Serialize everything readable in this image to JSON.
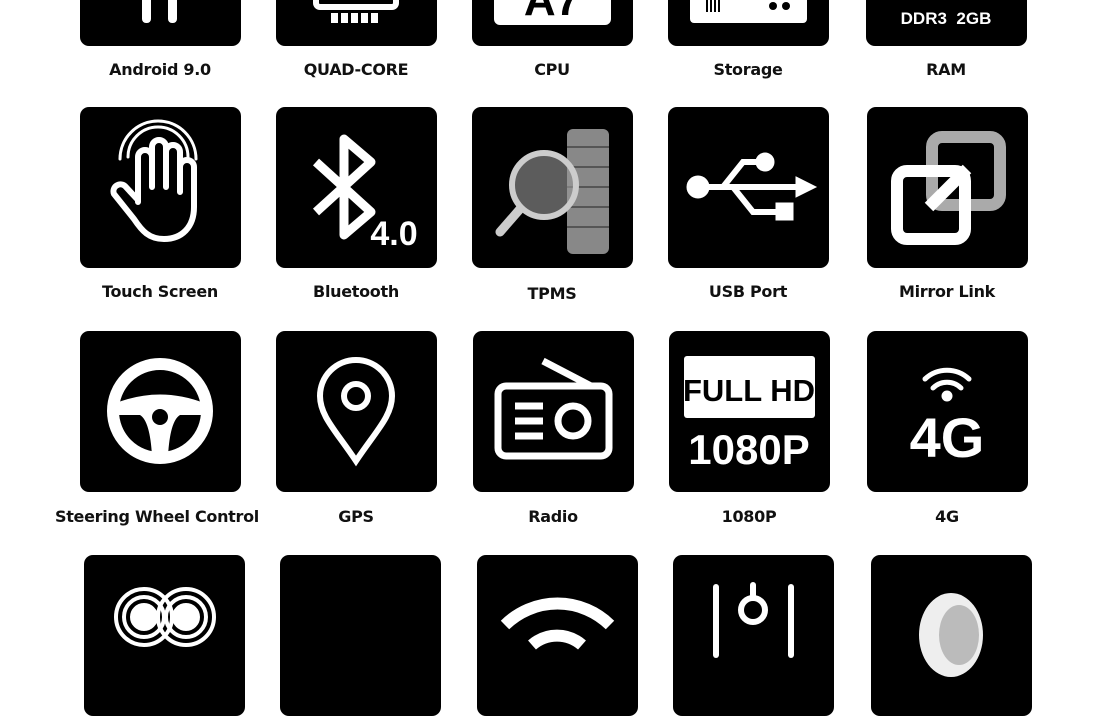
{
  "features": [
    {
      "label": "Android 9.0",
      "icon": "android-icon"
    },
    {
      "label": "QUAD-CORE",
      "icon": "chip-icon"
    },
    {
      "label": "CPU",
      "icon": "cpu-a7-icon",
      "badge": "A7"
    },
    {
      "label": "Storage",
      "icon": "storage-drive-icon"
    },
    {
      "label": "RAM",
      "icon": "ram-icon",
      "badge": "DDR3  2GB"
    },
    {
      "label": "Touch Screen",
      "icon": "touch-hand-icon"
    },
    {
      "label": "Bluetooth",
      "icon": "bluetooth-icon",
      "badge": "4.0"
    },
    {
      "label": "TPMS",
      "icon": "tire-magnifier-icon"
    },
    {
      "label": "USB Port",
      "icon": "usb-icon"
    },
    {
      "label": "Mirror Link",
      "icon": "mirror-link-icon"
    },
    {
      "label": "Steering Wheel Control",
      "icon": "steering-wheel-icon"
    },
    {
      "label": "GPS",
      "icon": "map-pin-icon"
    },
    {
      "label": "Radio",
      "icon": "radio-icon"
    },
    {
      "label": "1080P",
      "icon": "full-hd-icon",
      "badge_top": "FULL HD",
      "badge_bottom": "1080P"
    },
    {
      "label": "4G",
      "icon": "4g-signal-icon",
      "badge": "4G"
    },
    {
      "label": "",
      "icon": "camera-eyes-icon"
    },
    {
      "label": "",
      "icon": "blank-icon"
    },
    {
      "label": "",
      "icon": "wifi-icon"
    },
    {
      "label": "",
      "icon": "equalizer-icon"
    },
    {
      "label": "",
      "icon": "camera-lens-icon"
    }
  ]
}
